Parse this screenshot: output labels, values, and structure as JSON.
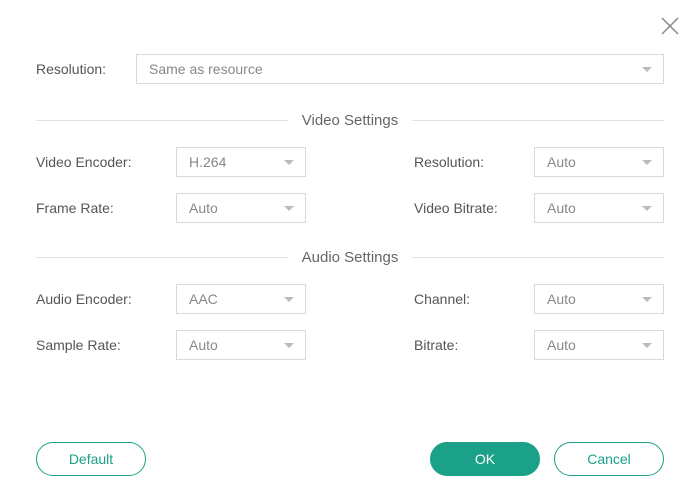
{
  "top": {
    "resolution_label": "Resolution:",
    "resolution_value": "Same as resource"
  },
  "sections": {
    "video_title": "Video Settings",
    "audio_title": "Audio Settings"
  },
  "video": {
    "encoder_label": "Video Encoder:",
    "encoder_value": "H.264",
    "resolution_label": "Resolution:",
    "resolution_value": "Auto",
    "frame_rate_label": "Frame Rate:",
    "frame_rate_value": "Auto",
    "bitrate_label": "Video Bitrate:",
    "bitrate_value": "Auto"
  },
  "audio": {
    "encoder_label": "Audio Encoder:",
    "encoder_value": "AAC",
    "channel_label": "Channel:",
    "channel_value": "Auto",
    "sample_rate_label": "Sample Rate:",
    "sample_rate_value": "Auto",
    "bitrate_label": "Bitrate:",
    "bitrate_value": "Auto"
  },
  "buttons": {
    "default": "Default",
    "ok": "OK",
    "cancel": "Cancel"
  }
}
